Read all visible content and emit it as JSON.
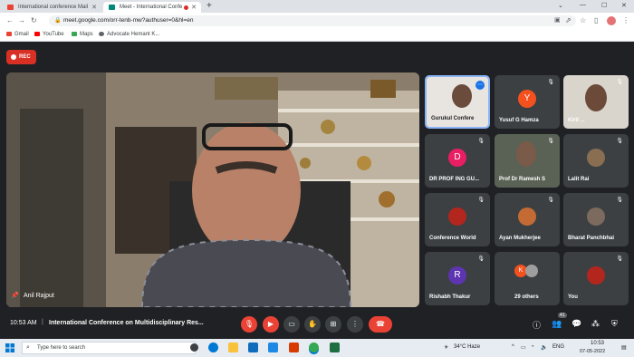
{
  "browser": {
    "tabs": [
      {
        "title": "International conference Mail",
        "favicon_color": "#ea4335"
      },
      {
        "title": "Meet - International Confe",
        "favicon_color": "#00897b"
      }
    ],
    "new_tab": "+",
    "url": "meet.google.com/orr-tenb-mw?authuser=0&hl=en",
    "bookmarks": [
      {
        "label": "Gmail",
        "color": "#ea4335"
      },
      {
        "label": "YouTube",
        "color": "#ff0000"
      },
      {
        "label": "Maps",
        "color": "#34a853"
      },
      {
        "label": "Advocate Hemant K...",
        "color": "#5f6368"
      }
    ]
  },
  "meet": {
    "rec_label": "REC",
    "main_speaker": "Anil Rajput",
    "participants": [
      {
        "name": "Gurukul Confere",
        "type": "video",
        "muted": false
      },
      {
        "name": "Yusuf G Hamza",
        "type": "initial",
        "initial": "Y",
        "color": "#f4511e",
        "muted": true
      },
      {
        "name": "Kirti ...",
        "type": "video",
        "muted": true
      },
      {
        "name": "DR PROF ING GU...",
        "type": "initial",
        "initial": "D",
        "color": "#e91e63",
        "muted": true
      },
      {
        "name": "Prof Dr Ramesh S",
        "type": "video",
        "muted": true
      },
      {
        "name": "Lalit Rai",
        "type": "photo",
        "muted": true
      },
      {
        "name": "Conference World",
        "type": "photo",
        "muted": true
      },
      {
        "name": "Ayan Mukherjee",
        "type": "photo",
        "muted": true
      },
      {
        "name": "Bharat Panchbhai",
        "type": "photo",
        "muted": true
      },
      {
        "name": "Rishabh Thakur",
        "type": "initial",
        "initial": "R",
        "color": "#5e35b1",
        "muted": true
      },
      {
        "name": "29 others",
        "type": "others",
        "initial": "K",
        "color": "#f4511e",
        "muted": false
      },
      {
        "name": "You",
        "type": "photo",
        "muted": true
      }
    ],
    "time": "10:53 AM",
    "meeting_title": "International Conference on Multidisciplinary Res...",
    "people_count": "41"
  },
  "taskbar": {
    "search_placeholder": "Type here to search",
    "weather": "34°C  Haze",
    "lang": "ENG",
    "clock_time": "10:53",
    "clock_date": "07-05-2022"
  }
}
